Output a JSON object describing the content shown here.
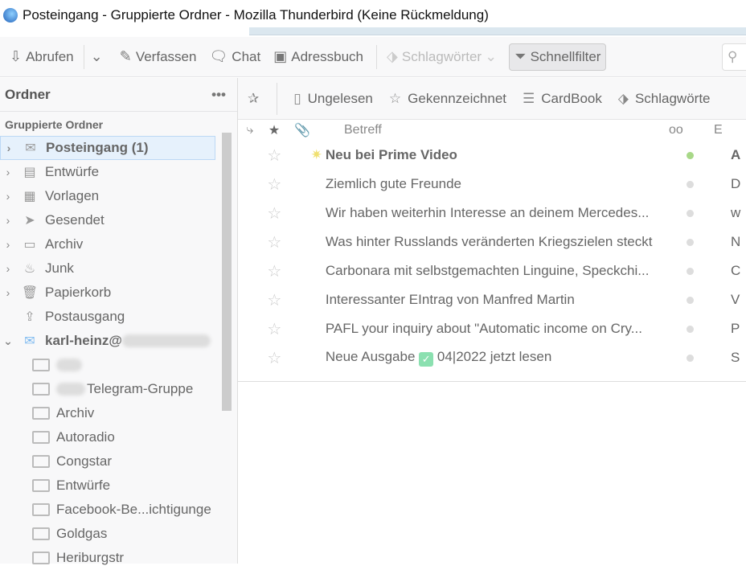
{
  "window": {
    "title": "Posteingang - Gruppierte Ordner - Mozilla Thunderbird (Keine Rückmeldung)"
  },
  "toolbar": {
    "get": "Abrufen",
    "compose": "Verfassen",
    "chat": "Chat",
    "addressbook": "Adressbuch",
    "tags": "Schlagwörter",
    "quickfilter": "Schnellfilter"
  },
  "folders": {
    "header": "Ordner",
    "more": "•••",
    "group": "Gruppierte Ordner",
    "items": [
      {
        "label": "Posteingang (1)",
        "icon": "inbox-icon"
      },
      {
        "label": "Entwürfe",
        "icon": "drafts-icon"
      },
      {
        "label": "Vorlagen",
        "icon": "templates-icon"
      },
      {
        "label": "Gesendet",
        "icon": "sent-icon"
      },
      {
        "label": "Archiv",
        "icon": "archive-icon"
      },
      {
        "label": "Junk",
        "icon": "junk-icon"
      },
      {
        "label": "Papierkorb",
        "icon": "trash-icon"
      },
      {
        "label": "Postausgang",
        "icon": "outbox-icon"
      }
    ],
    "account": "karl-heinz@",
    "subfolders": [
      "",
      "Telegram-Gruppe",
      "Archiv",
      "Autoradio",
      "Congstar",
      "Entwürfe",
      "Facebook-Be...ichtigunge",
      "Goldgas",
      "Heriburgstr"
    ]
  },
  "quickfilter": {
    "unread": "Ungelesen",
    "starred": "Gekennzeichnet",
    "cardbook": "CardBook",
    "tags": "Schlagwörte"
  },
  "messages": {
    "col_subject": "Betreff",
    "col_sender": "E",
    "rows": [
      {
        "subject": "Neu bei Prime Video",
        "sender": "A",
        "unread": true
      },
      {
        "subject": "Ziemlich gute Freunde",
        "sender": "D"
      },
      {
        "subject": "Wir haben weiterhin Interesse an deinem Mercedes...",
        "sender": "w"
      },
      {
        "subject": "Was hinter Russlands veränderten Kriegszielen steckt",
        "sender": "N"
      },
      {
        "subject": "Carbonara mit selbstgemachten Linguine, Speckchi...",
        "sender": "C"
      },
      {
        "subject": "Interessanter EIntrag von Manfred Martin",
        "sender": "V"
      },
      {
        "subject": "PAFL your inquiry about \"Automatic income on Cry...",
        "sender": "P"
      },
      {
        "subject_a": "Neue Ausgabe",
        "subject_b": "04|2022 jetzt lesen",
        "sender": "S"
      }
    ]
  }
}
